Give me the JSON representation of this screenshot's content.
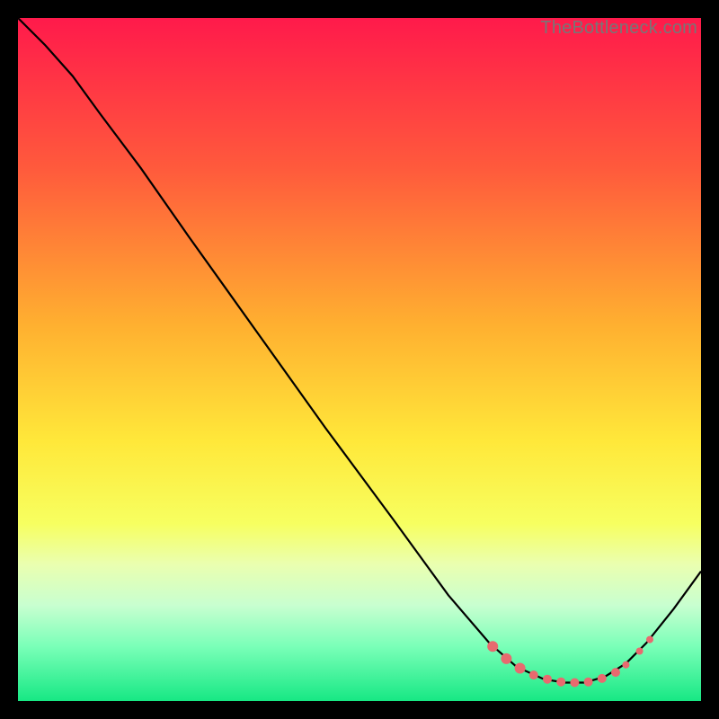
{
  "watermark": "TheBottleneck.com",
  "chart_data": {
    "type": "line",
    "title": "",
    "xlabel": "",
    "ylabel": "",
    "xlim": [
      0,
      100
    ],
    "ylim": [
      0,
      100
    ],
    "gradient_stops": [
      {
        "offset": 0,
        "color": "#ff1a4b"
      },
      {
        "offset": 22,
        "color": "#ff5a3c"
      },
      {
        "offset": 45,
        "color": "#ffb030"
      },
      {
        "offset": 62,
        "color": "#ffe83a"
      },
      {
        "offset": 74,
        "color": "#f7ff60"
      },
      {
        "offset": 80,
        "color": "#eaffb0"
      },
      {
        "offset": 86,
        "color": "#c8ffd0"
      },
      {
        "offset": 92,
        "color": "#7affb8"
      },
      {
        "offset": 100,
        "color": "#17e884"
      }
    ],
    "curve": [
      {
        "x": 0.0,
        "y": 100.0
      },
      {
        "x": 4.0,
        "y": 96.0
      },
      {
        "x": 8.0,
        "y": 91.5
      },
      {
        "x": 12.0,
        "y": 86.0
      },
      {
        "x": 18.0,
        "y": 78.0
      },
      {
        "x": 25.0,
        "y": 68.0
      },
      {
        "x": 35.0,
        "y": 54.0
      },
      {
        "x": 45.0,
        "y": 40.0
      },
      {
        "x": 55.0,
        "y": 26.5
      },
      {
        "x": 63.0,
        "y": 15.5
      },
      {
        "x": 69.0,
        "y": 8.5
      },
      {
        "x": 73.0,
        "y": 5.0
      },
      {
        "x": 77.0,
        "y": 3.2
      },
      {
        "x": 80.0,
        "y": 2.7
      },
      {
        "x": 83.0,
        "y": 2.7
      },
      {
        "x": 86.0,
        "y": 3.6
      },
      {
        "x": 89.0,
        "y": 5.5
      },
      {
        "x": 92.0,
        "y": 8.5
      },
      {
        "x": 96.0,
        "y": 13.5
      },
      {
        "x": 100.0,
        "y": 19.0
      }
    ],
    "markers": [
      {
        "x": 69.5,
        "y": 8.0,
        "r": 6
      },
      {
        "x": 71.5,
        "y": 6.2,
        "r": 6
      },
      {
        "x": 73.5,
        "y": 4.8,
        "r": 6
      },
      {
        "x": 75.5,
        "y": 3.8,
        "r": 5
      },
      {
        "x": 77.5,
        "y": 3.2,
        "r": 5
      },
      {
        "x": 79.5,
        "y": 2.8,
        "r": 5
      },
      {
        "x": 81.5,
        "y": 2.7,
        "r": 5
      },
      {
        "x": 83.5,
        "y": 2.8,
        "r": 5
      },
      {
        "x": 85.5,
        "y": 3.3,
        "r": 5
      },
      {
        "x": 87.5,
        "y": 4.2,
        "r": 5
      },
      {
        "x": 89.0,
        "y": 5.3,
        "r": 4
      },
      {
        "x": 91.0,
        "y": 7.3,
        "r": 4
      },
      {
        "x": 92.5,
        "y": 9.0,
        "r": 4
      }
    ],
    "marker_color": "#e86a6f",
    "curve_color": "#000000"
  }
}
